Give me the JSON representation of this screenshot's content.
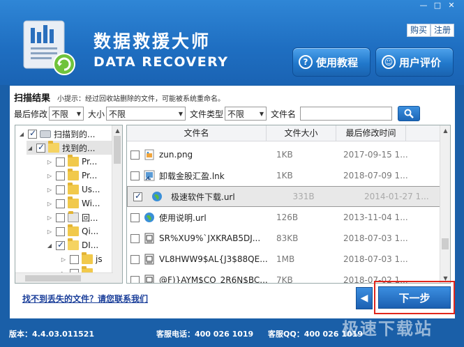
{
  "header": {
    "title_cn": "数据救援大师",
    "title_en": "DATA RECOVERY",
    "buy_label": "购买",
    "register_label": "注册",
    "tutorial_label": "使用教程",
    "review_label": "用户评价",
    "window": {
      "minimize": "—",
      "restore": "□",
      "close": "✕"
    }
  },
  "scan": {
    "title": "扫描结果",
    "tip": "小提示：经过回收站删除的文件，可能被系统重命名。"
  },
  "filters": {
    "modified_label": "最后修改",
    "modified_value": "不限",
    "size_label": "大小",
    "size_value": "不限",
    "type_label": "文件类型",
    "type_value": "不限",
    "name_label": "文件名",
    "name_value": ""
  },
  "tree": {
    "items": [
      {
        "label": "扫描到的...",
        "checked": true
      },
      {
        "label": "找到的...",
        "checked": true
      },
      {
        "label": "Pr...",
        "checked": false
      },
      {
        "label": "Pr...",
        "checked": false
      },
      {
        "label": "Us...",
        "checked": false
      },
      {
        "label": "Wi...",
        "checked": false
      },
      {
        "label": "回...",
        "checked": false
      },
      {
        "label": "Qi...",
        "checked": false
      },
      {
        "label": "DI...",
        "checked": true
      },
      {
        "label": "js",
        "checked": false
      },
      {
        "label": "",
        "checked": false
      },
      {
        "label": "",
        "checked": false
      }
    ]
  },
  "files": {
    "columns": [
      "文件名",
      "文件大小",
      "最后修改时间"
    ],
    "rows": [
      {
        "name": "zun.png",
        "size": "1KB",
        "date": "2017-09-15 1...",
        "checked": false,
        "icon": "image-file-icon"
      },
      {
        "name": "卸载金股汇盈.lnk",
        "size": "1KB",
        "date": "2018-07-09 1...",
        "checked": false,
        "icon": "shortcut-file-icon"
      },
      {
        "name": "极速软件下载.url",
        "size": "331B",
        "date": "2014-01-27 1...",
        "checked": true,
        "icon": "url-file-icon"
      },
      {
        "name": "使用说明.url",
        "size": "126B",
        "date": "2013-11-04 1...",
        "checked": false,
        "icon": "url-file-icon"
      },
      {
        "name": "SR%XU9%`JXKRAB5DJ...",
        "size": "83KB",
        "date": "2018-07-03 1...",
        "checked": false,
        "icon": "document-file-icon"
      },
      {
        "name": "VL8HWW9$AL{J3$88QE...",
        "size": "1MB",
        "date": "2018-07-03 1...",
        "checked": false,
        "icon": "document-file-icon"
      },
      {
        "name": "@F)}AYM$CO_2R6N$BC...",
        "size": "7KB",
        "date": "2018-07-02 1...",
        "checked": false,
        "icon": "document-file-icon"
      }
    ]
  },
  "actions": {
    "help_link": "找不到丢失的文件？请您联系我们",
    "prev_label": "◀",
    "next_label": "下一步"
  },
  "footer": {
    "version": "版本：4.4.03.011521",
    "phone": "客服电话：400 026 1019",
    "qq": "客服QQ：400 026 1019"
  },
  "watermark": "极速下载站"
}
